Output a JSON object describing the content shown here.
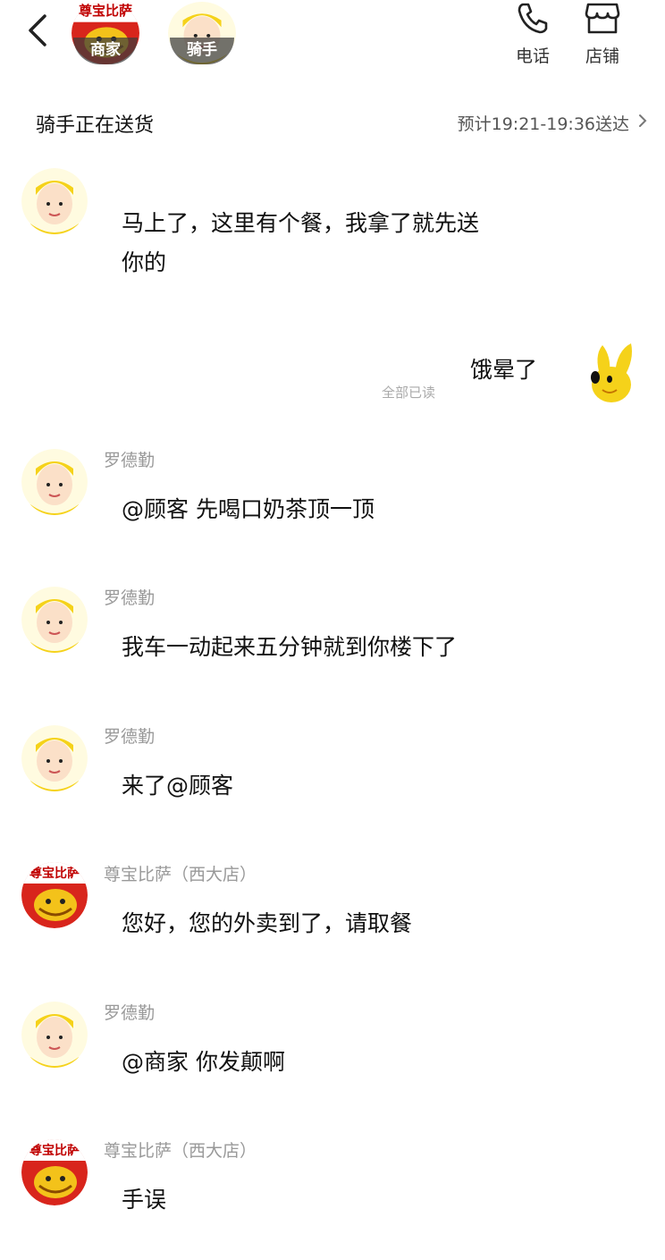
{
  "header": {
    "merchant_tag": "商家",
    "merchant_sign": "尊宝比萨",
    "rider_tag": "骑手",
    "phone_label": "电话",
    "store_label": "店铺",
    "icons": {
      "back": "chevron-left-icon",
      "phone": "phone-icon",
      "store": "store-icon",
      "eta_arrow": "chevron-right-icon"
    }
  },
  "status": {
    "text": "骑手正在送货",
    "eta": "预计19:21-19:36送达"
  },
  "messages": [
    {
      "sender": "",
      "text_line1": "马上了，这里有个餐，我拿了就先送",
      "text_line2": "你的"
    },
    {
      "mine": true,
      "text": "饿晕了",
      "read_status": "全部已读"
    },
    {
      "sender": "罗德勤",
      "text": "@顾客 先喝口奶茶顶一顶"
    },
    {
      "sender": "罗德勤",
      "text": "我车一动起来五分钟就到你楼下了"
    },
    {
      "sender": "罗德勤",
      "text": "来了@顾客"
    },
    {
      "sender": "尊宝比萨（西大店）",
      "store_sign": "尊宝比萨",
      "text": "您好，您的外卖到了，请取餐"
    },
    {
      "sender": "罗德勤",
      "text": "@商家 你发颠啊"
    },
    {
      "sender": "尊宝比萨（西大店）",
      "store_sign": "尊宝比萨",
      "text": "手误"
    }
  ]
}
